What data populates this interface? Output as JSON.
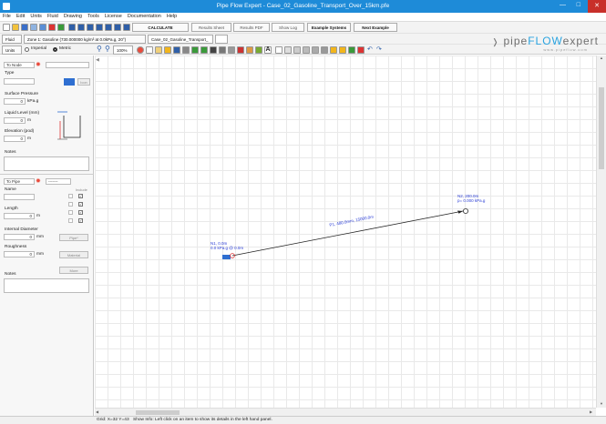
{
  "window": {
    "title": "Pipe Flow Expert - Case_02_Gasoline_Transport_Over_15km.pfe"
  },
  "menu": [
    "File",
    "Edit",
    "Units",
    "Fluid",
    "Drawing",
    "Tools",
    "License",
    "Documentation",
    "Help"
  ],
  "toolbar": {
    "calculate": "CALCULATE",
    "results_sheet": "Results Sheet",
    "results_pdf": "Results PDF",
    "show_log": "Show Log",
    "example_systems": "Example Systems",
    "next_example": "Next Example"
  },
  "fluid_bar": {
    "fluid_btn": "Fluid",
    "fluid_zone": "Zone 1: Gasoline (730.000000 kg/m³ at 0.0kPa.g, 20°)",
    "tab_name": "Case_02_Gasoline_Transport_"
  },
  "units_bar": {
    "units_btn": "Units",
    "imperial": "Imperial",
    "metric": "Metric",
    "zoom": "100%"
  },
  "logo": {
    "text1": "pipe",
    "text2": "FLOW",
    "text3": "expert",
    "url": "www.pipeflow.com"
  },
  "node_panel": {
    "selector": "To Node",
    "type_label": "Type",
    "icon_btn": "Icon",
    "surface_pressure_label": "Surface Pressure",
    "surface_pressure_value": "0",
    "surface_pressure_unit": "kPa.g",
    "liquid_level_label": "Liquid Level (mm)",
    "liquid_level_value": "0",
    "liquid_level_unit": "m",
    "elevation_label": "Elevation (pod)",
    "elevation_value": "0",
    "elevation_unit": "m",
    "notes_label": "Notes"
  },
  "pipe_panel": {
    "selector": "To Pipe",
    "pipe_selector": "-------",
    "name_label": "Name",
    "include_label": "Include",
    "length_label": "Length",
    "length_value": "0",
    "length_unit": "m",
    "internal_diameter_label": "Internal Diameter",
    "internal_diameter_value": "0",
    "internal_diameter_unit": "mm",
    "pipe_btn": "Pipe*",
    "roughness_label": "Roughness",
    "roughness_value": "0",
    "roughness_unit": "mm",
    "material_btn": "Material",
    "notes_label": "Notes",
    "more_btn": "More"
  },
  "diagram": {
    "node1_line1": "N1, 0.0m",
    "node1_line2": "0.0 kPa.g @ 0.0m",
    "node2_line1": "N2, 200.0m",
    "node2_line2": "p= 0.000 kPa.g",
    "pipe_label": "P1, 480.0mm, 15000.0m"
  },
  "status": {
    "grid": "Grid: X=32 Y=43",
    "info": "Show Info: Left click on an item to show its details in the left hand panel."
  }
}
